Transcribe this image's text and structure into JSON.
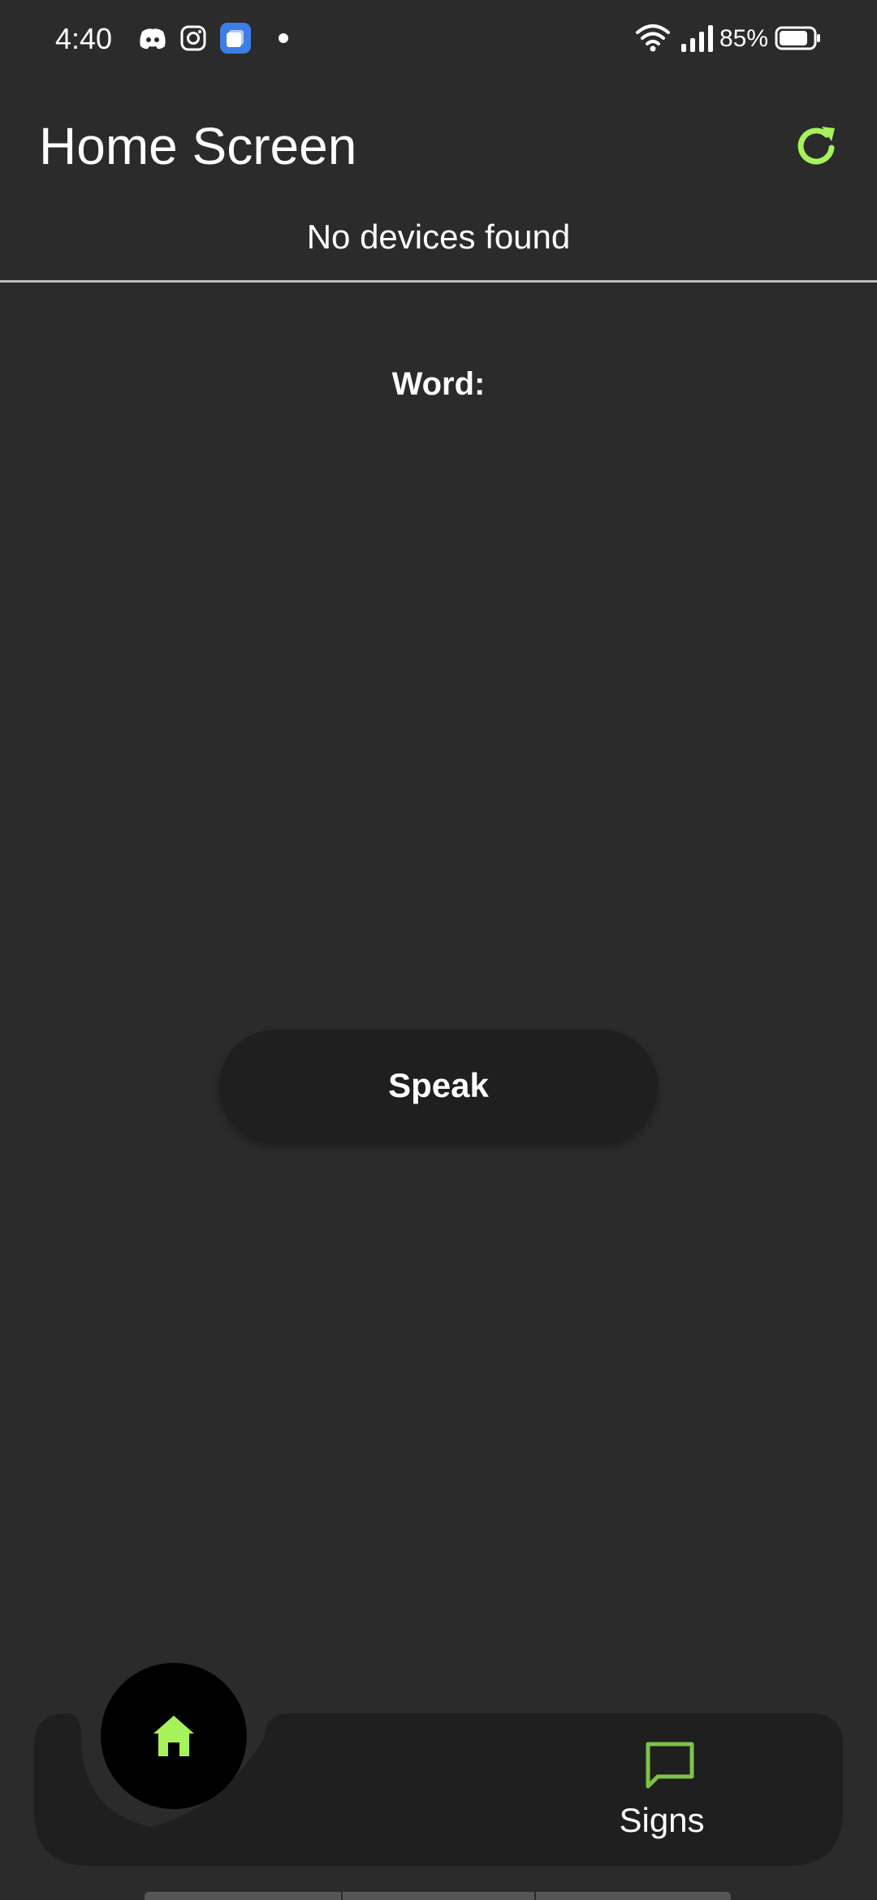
{
  "status_bar": {
    "time": "4:40",
    "battery_percent": "85%",
    "battery_level": 0.85,
    "notification_icons": [
      "discord-icon",
      "instagram-icon",
      "app-icon",
      "dot-icon"
    ],
    "system_icons": [
      "wifi-icon",
      "signal-icon",
      "battery-icon"
    ]
  },
  "app_bar": {
    "title": "Home Screen",
    "refresh_icon": "refresh-icon"
  },
  "device_status": "No devices found",
  "content": {
    "word_label": "Word:",
    "speak_label": "Speak"
  },
  "bottom_nav": {
    "home_icon": "home-icon",
    "signs_label": "Signs",
    "signs_icon": "chat-icon"
  },
  "colors": {
    "background": "#2b2b2b",
    "accent": "#a6f25a",
    "nav_background": "#1f1f1f",
    "button_background": "#1f1f1f"
  }
}
